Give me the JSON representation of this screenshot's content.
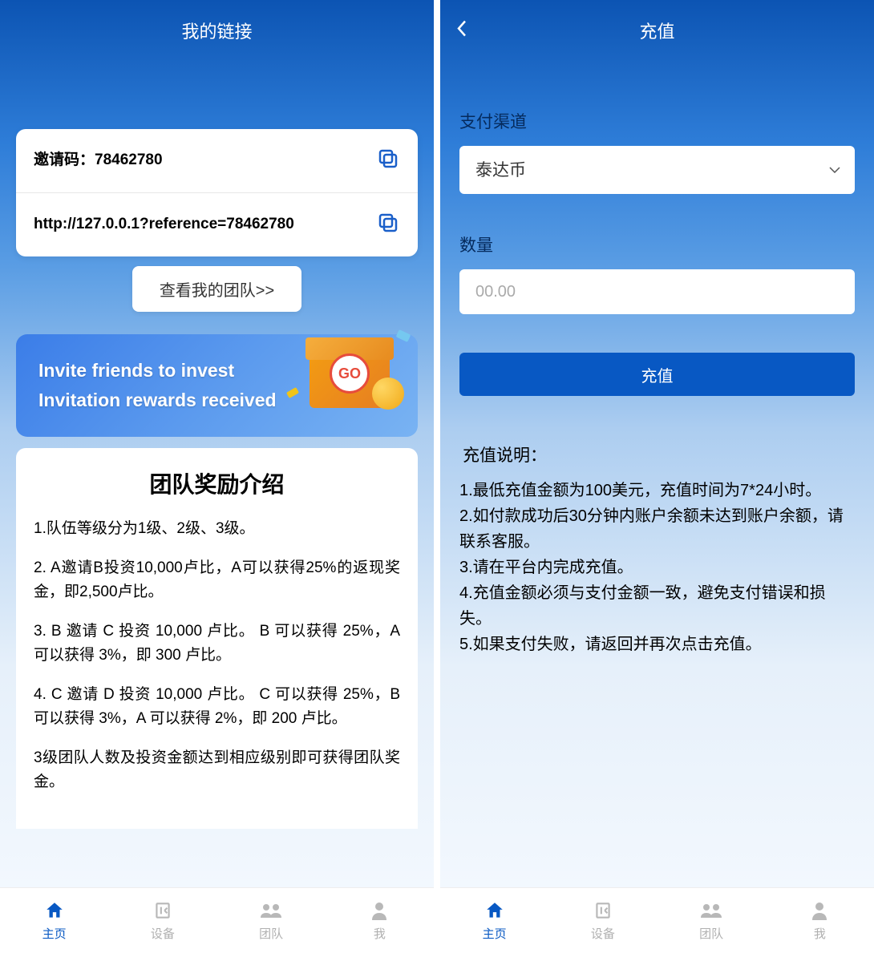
{
  "left": {
    "header_title": "我的链接",
    "invite_code_label": "邀请码：",
    "invite_code_value": "78462780",
    "invite_url": "http://127.0.0.1?reference=78462780",
    "team_button": "查看我的团队>>",
    "banner_line1": "Invite friends to invest",
    "banner_line2": "Invitation rewards received",
    "banner_go": "GO",
    "reward_title": "团队奖励介绍",
    "reward_items": [
      "1.队伍等级分为1级、2级、3级。",
      "2. A邀请B投资10,000卢比，A可以获得25%的返现奖金，即2,500卢比。",
      "3. B 邀请 C 投资 10,000 卢比。 B 可以获得 25%，A 可以获得 3%，即 300 卢比。",
      "4. C 邀请 D 投资 10,000 卢比。 C 可以获得 25%，B 可以获得 3%，A 可以获得 2%，即 200 卢比。",
      "3级团队人数及投资金额达到相应级别即可获得团队奖金。"
    ]
  },
  "right": {
    "header_title": "充值",
    "channel_label": "支付渠道",
    "channel_value": "泰达币",
    "amount_label": "数量",
    "amount_placeholder": "00.00",
    "submit_label": "充值",
    "desc_title": "充值说明：",
    "desc_lines": [
      "1.最低充值金额为100美元，充值时间为7*24小时。",
      "2.如付款成功后30分钟内账户余额未达到账户余额，请联系客服。",
      "3.请在平台内完成充值。",
      "4.充值金额必须与支付金额一致，避免支付错误和损失。",
      "5.如果支付失败，请返回并再次点击充值。"
    ]
  },
  "tabs": [
    {
      "label": "主页",
      "active": true
    },
    {
      "label": "设备",
      "active": false
    },
    {
      "label": "团队",
      "active": false
    },
    {
      "label": "我",
      "active": false
    }
  ]
}
